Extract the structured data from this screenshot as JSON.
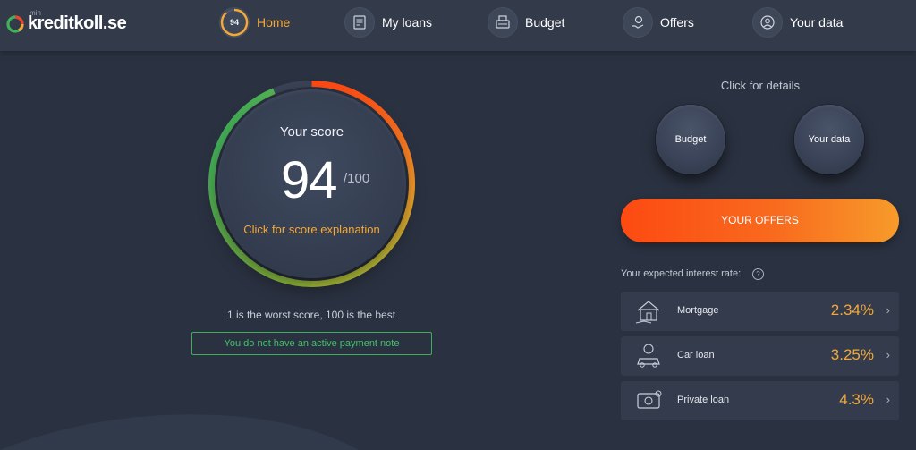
{
  "brand": {
    "small": "min",
    "name": "kreditkoll.se"
  },
  "nav": {
    "home": {
      "badge": "94",
      "label": "Home"
    },
    "loans": {
      "label": "My loans",
      "icon": "document-icon"
    },
    "budget": {
      "label": "Budget",
      "icon": "cash-register-icon"
    },
    "offers": {
      "label": "Offers",
      "icon": "hand-coin-icon"
    },
    "data": {
      "label": "Your data",
      "icon": "profile-icon"
    }
  },
  "score": {
    "title": "Your score",
    "value": "94",
    "max": "/100",
    "link": "Click for score explanation",
    "caption": "1 is the worst score, 100 is the best",
    "payment_note": "You do not have an active payment note",
    "progress": 0.94
  },
  "details": {
    "title": "Click for details",
    "budget": "Budget",
    "your_data": "Your data",
    "offers_button": "YOUR OFFERS"
  },
  "rates": {
    "title": "Your expected interest rate:",
    "help": "?",
    "items": [
      {
        "label": "Mortgage",
        "value": "2.34%",
        "icon": "house-icon"
      },
      {
        "label": "Car loan",
        "value": "3.25%",
        "icon": "car-icon"
      },
      {
        "label": "Private loan",
        "value": "4.3%",
        "icon": "money-icon"
      }
    ],
    "chevron": "›"
  },
  "colors": {
    "background": "#2a3140",
    "nav": "#333b4b",
    "accent": "#f3a83a",
    "offers_start": "#fd4a12",
    "offers_end": "#f79b2a",
    "success": "#3fc365"
  }
}
